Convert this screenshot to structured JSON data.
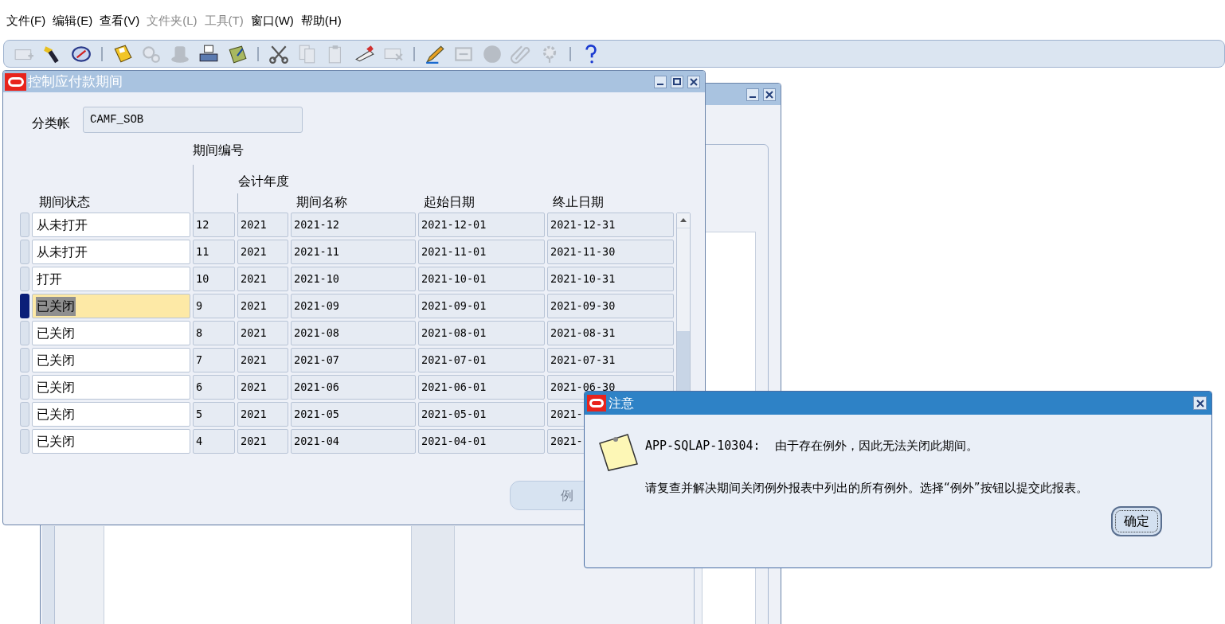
{
  "menu": [
    {
      "label": "文件(F)",
      "disabled": false
    },
    {
      "label": "编辑(E)",
      "disabled": false
    },
    {
      "label": "查看(V)",
      "disabled": false
    },
    {
      "label": "文件夹(L)",
      "disabled": true
    },
    {
      "label": "工具(T)",
      "disabled": true
    },
    {
      "label": "窗口(W)",
      "disabled": false
    },
    {
      "label": "帮助(H)",
      "disabled": false
    }
  ],
  "toolbar": [
    {
      "kind": "new",
      "disabled": true
    },
    {
      "kind": "find",
      "disabled": false
    },
    {
      "kind": "navigator",
      "disabled": false
    },
    {
      "kind": "separator"
    },
    {
      "kind": "save",
      "disabled": false
    },
    {
      "kind": "next-step",
      "disabled": true
    },
    {
      "kind": "switch",
      "disabled": true
    },
    {
      "kind": "print",
      "disabled": false
    },
    {
      "kind": "close-form",
      "disabled": false
    },
    {
      "kind": "separator"
    },
    {
      "kind": "cut",
      "disabled": false
    },
    {
      "kind": "copy",
      "disabled": true
    },
    {
      "kind": "paste",
      "disabled": true
    },
    {
      "kind": "clear",
      "disabled": false
    },
    {
      "kind": "delete",
      "disabled": true
    },
    {
      "kind": "separator"
    },
    {
      "kind": "edit",
      "disabled": false
    },
    {
      "kind": "zoom",
      "disabled": true
    },
    {
      "kind": "translate",
      "disabled": true
    },
    {
      "kind": "attach",
      "disabled": true
    },
    {
      "kind": "folder-tools",
      "disabled": true
    },
    {
      "kind": "separator"
    },
    {
      "kind": "help",
      "disabled": false
    }
  ],
  "form_window": {
    "title": "控制应付款期间",
    "ledger": {
      "label": "分类帐",
      "value": "CAMF_SOB"
    },
    "columns": [
      "期间状态",
      "期间编号",
      "会计年度",
      "期间名称",
      "起始日期",
      "终止日期"
    ],
    "rows": [
      {
        "status": "从未打开",
        "number": "12",
        "year": "2021",
        "name": "2021-12",
        "start": "2021-12-01",
        "end": "2021-12-31",
        "selected": false
      },
      {
        "status": "从未打开",
        "number": "11",
        "year": "2021",
        "name": "2021-11",
        "start": "2021-11-01",
        "end": "2021-11-30",
        "selected": false
      },
      {
        "status": "打开",
        "number": "10",
        "year": "2021",
        "name": "2021-10",
        "start": "2021-10-01",
        "end": "2021-10-31",
        "selected": false
      },
      {
        "status": "已关闭",
        "number": "9",
        "year": "2021",
        "name": "2021-09",
        "start": "2021-09-01",
        "end": "2021-09-30",
        "selected": true
      },
      {
        "status": "已关闭",
        "number": "8",
        "year": "2021",
        "name": "2021-08",
        "start": "2021-08-01",
        "end": "2021-08-31",
        "selected": false
      },
      {
        "status": "已关闭",
        "number": "7",
        "year": "2021",
        "name": "2021-07",
        "start": "2021-07-01",
        "end": "2021-07-31",
        "selected": false
      },
      {
        "status": "已关闭",
        "number": "6",
        "year": "2021",
        "name": "2021-06",
        "start": "2021-06-01",
        "end": "2021-06-30",
        "selected": false
      },
      {
        "status": "已关闭",
        "number": "5",
        "year": "2021",
        "name": "2021-05",
        "start": "2021-05-01",
        "end": "2021-",
        "selected": false
      },
      {
        "status": "已关闭",
        "number": "4",
        "year": "2021",
        "name": "2021-04",
        "start": "2021-04-01",
        "end": "2021-",
        "selected": false
      }
    ],
    "button": "例"
  },
  "dialog": {
    "title": "注意",
    "message": "APP-SQLAP-10304:  由于存在例外，因此无法关闭此期间。",
    "detail": "请复查并解决期间关闭例外报表中列出的所有例外。选择“例外”按钮以提交此报表。",
    "button": "确定"
  }
}
